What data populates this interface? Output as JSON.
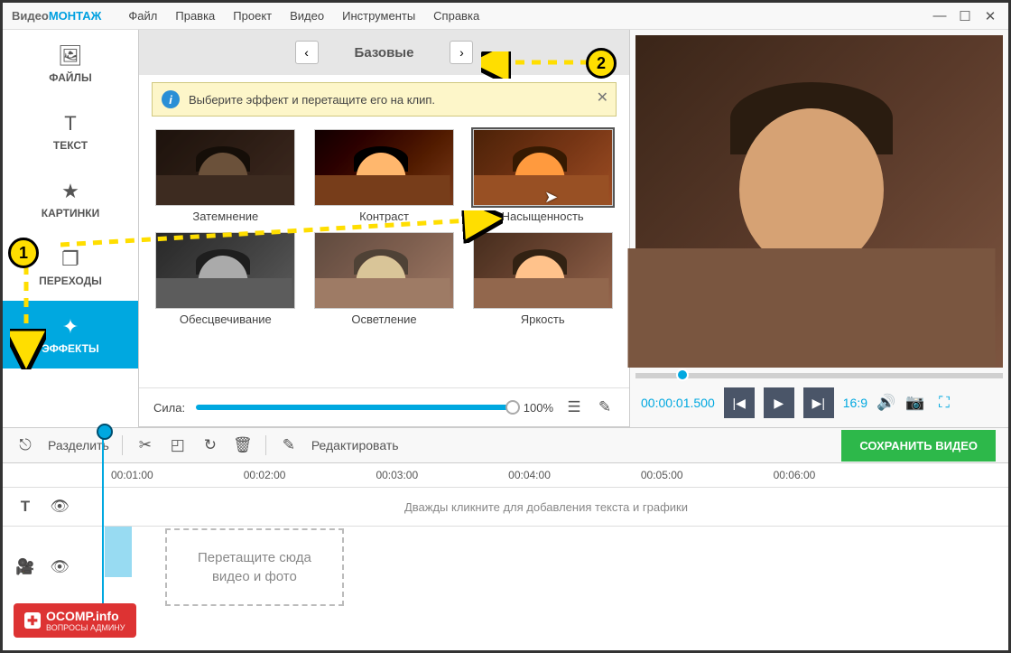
{
  "brand": {
    "p1": "Видео",
    "p2": "МОНТАЖ"
  },
  "menu": [
    "Файл",
    "Правка",
    "Проект",
    "Видео",
    "Инструменты",
    "Справка"
  ],
  "sidebar": [
    {
      "label": "ФАЙЛЫ",
      "icon": "🖼"
    },
    {
      "label": "ТЕКСТ",
      "icon": "T"
    },
    {
      "label": "КАРТИНКИ",
      "icon": "★"
    },
    {
      "label": "ПЕРЕХОДЫ",
      "icon": "❐"
    },
    {
      "label": "ЭФФЕКТЫ",
      "icon": "✦"
    }
  ],
  "tabs": {
    "current": "Базовые"
  },
  "hint": "Выберите эффект и перетащите его на клип.",
  "effects": [
    "Затемнение",
    "Контраст",
    "Насыщенность",
    "Обесцвечивание",
    "Осветление",
    "Яркость"
  ],
  "strength": {
    "label": "Сила:",
    "value": "100%"
  },
  "player": {
    "time": "00:00:01.500",
    "ratio": "16:9"
  },
  "toolbar": {
    "split": "Разделить",
    "edit": "Редактировать",
    "save": "СОХРАНИТЬ ВИДЕО"
  },
  "ruler": [
    "00:01:00",
    "00:02:00",
    "00:03:00",
    "00:04:00",
    "00:05:00",
    "00:06:00"
  ],
  "text_track_hint": "Дважды кликните для добавления текста и графики",
  "dropzone": "Перетащите сюда\nвидео и фото",
  "annotations": {
    "a1": "1",
    "a2": "2"
  },
  "watermark": {
    "line1": "OCOMP.info",
    "line2": "ВОПРОСЫ АДМИНУ"
  }
}
